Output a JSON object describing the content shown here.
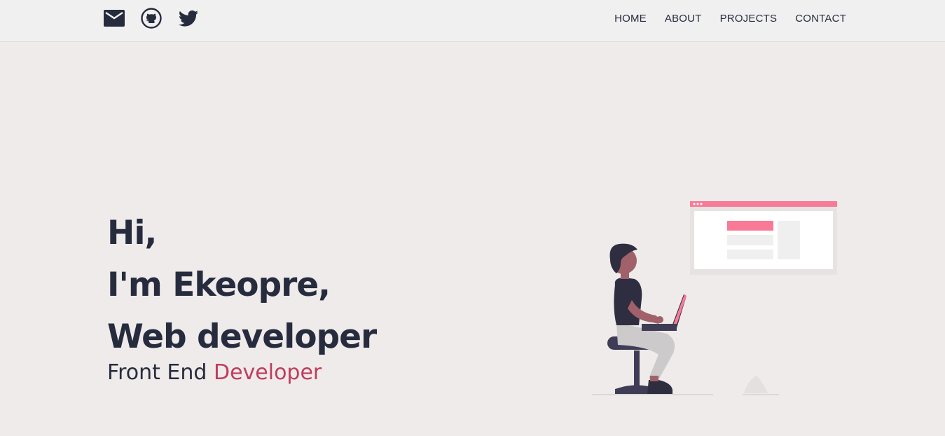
{
  "social": {
    "icons": [
      "mail-icon",
      "github-icon",
      "twitter-icon"
    ]
  },
  "nav": {
    "items": [
      {
        "label": "HOME"
      },
      {
        "label": "ABOUT"
      },
      {
        "label": "PROJECTS"
      },
      {
        "label": "CONTACT"
      }
    ]
  },
  "hero": {
    "greeting": "Hi,",
    "intro": "I'm Ekeopre,",
    "role": "Web developer",
    "subtitle_prefix": "Front End ",
    "subtitle_accent": "Developer"
  },
  "colors": {
    "text": "#262c3e",
    "accent": "#bd3d5d",
    "pink": "#f87a97",
    "background": "#efebea"
  }
}
